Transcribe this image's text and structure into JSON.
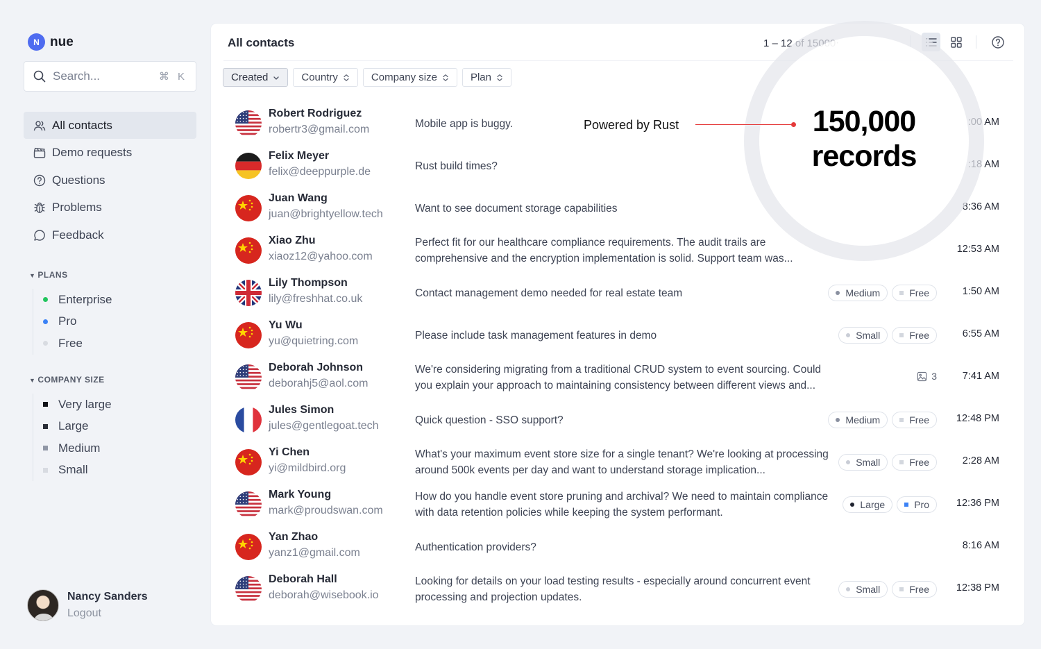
{
  "brand": {
    "logo_letter": "N",
    "name": "nue"
  },
  "search": {
    "placeholder": "Search...",
    "shortcut": "⌘ K"
  },
  "nav": [
    {
      "label": "All contacts",
      "icon": "users-icon",
      "active": true
    },
    {
      "label": "Demo requests",
      "icon": "clapperboard-icon",
      "active": false
    },
    {
      "label": "Questions",
      "icon": "question-circle-icon",
      "active": false
    },
    {
      "label": "Problems",
      "icon": "bug-icon",
      "active": false
    },
    {
      "label": "Feedback",
      "icon": "chat-bubble-icon",
      "active": false
    }
  ],
  "plans": {
    "heading": "PLANS",
    "items": [
      {
        "label": "Enterprise",
        "color": "#22c55e"
      },
      {
        "label": "Pro",
        "color": "#3b82f6"
      },
      {
        "label": "Free",
        "color": "#d8dbe1"
      }
    ]
  },
  "company_size": {
    "heading": "COMPANY SIZE",
    "items": [
      {
        "label": "Very large",
        "color": "#111318"
      },
      {
        "label": "Large",
        "color": "#2a2e38"
      },
      {
        "label": "Medium",
        "color": "#9097a6"
      },
      {
        "label": "Small",
        "color": "#d8dbe1"
      }
    ]
  },
  "user": {
    "name": "Nancy Sanders",
    "logout": "Logout"
  },
  "main": {
    "title": "All contacts",
    "pagination": "1 – 12 of 15000‧",
    "filters": [
      "Created",
      "Country",
      "Company size",
      "Plan"
    ]
  },
  "overlay": {
    "powered_by": "Powered by Rust",
    "big_line1": "150,000",
    "big_line2": "records"
  },
  "contacts": [
    {
      "name": "Robert Rodriguez",
      "email": "robertr3@gmail.com",
      "flag": "us",
      "message": "Mobile app is buggy.",
      "size": "",
      "plan": "",
      "attachments": "",
      "time": ":00 AM"
    },
    {
      "name": "Felix Meyer",
      "email": "felix@deeppurple.de",
      "flag": "de",
      "message": "Rust build times?",
      "size": "",
      "plan": "",
      "attachments": "",
      "time": ":18 AM"
    },
    {
      "name": "Juan Wang",
      "email": "juan@brightyellow.tech",
      "flag": "cn",
      "message": "Want to see document storage capabilities",
      "size": "",
      "plan": "",
      "attachments": "",
      "time": "8:36 AM"
    },
    {
      "name": "Xiao Zhu",
      "email": "xiaoz12@yahoo.com",
      "flag": "cn",
      "message": "Perfect fit for our healthcare compliance requirements. The audit trails are comprehensive and the encryption implementation is solid. Support team was...",
      "size": "",
      "plan": "",
      "attachments": "",
      "time": "12:53 AM"
    },
    {
      "name": "Lily Thompson",
      "email": "lily@freshhat.co.uk",
      "flag": "gb",
      "message": "Contact management demo needed for real estate team",
      "size": "Medium",
      "plan": "Free",
      "attachments": "",
      "time": "1:50 AM"
    },
    {
      "name": "Yu Wu",
      "email": "yu@quietring.com",
      "flag": "cn",
      "message": "Please include task management features in demo",
      "size": "Small",
      "plan": "Free",
      "attachments": "",
      "time": "6:55 AM"
    },
    {
      "name": "Deborah Johnson",
      "email": "deborahj5@aol.com",
      "flag": "us",
      "message": "We're considering migrating from a traditional CRUD system to event sourcing. Could you explain your approach to maintaining consistency between different views and...",
      "size": "",
      "plan": "",
      "attachments": "3",
      "time": "7:41 AM"
    },
    {
      "name": "Jules Simon",
      "email": "jules@gentlegoat.tech",
      "flag": "fr",
      "message": "Quick question - SSO support?",
      "size": "Medium",
      "plan": "Free",
      "attachments": "",
      "time": "12:48 PM"
    },
    {
      "name": "Yi Chen",
      "email": "yi@mildbird.org",
      "flag": "cn",
      "message": "What's your maximum event store size for a single tenant? We're looking at processing around 500k events per day and want to understand storage implication...",
      "size": "Small",
      "plan": "Free",
      "attachments": "",
      "time": "2:28 AM"
    },
    {
      "name": "Mark Young",
      "email": "mark@proudswan.com",
      "flag": "us",
      "message": "How do you handle event store pruning and archival? We need to maintain compliance with data retention policies while keeping the system performant.",
      "size": "Large",
      "plan": "Pro",
      "attachments": "",
      "time": "12:36 PM"
    },
    {
      "name": "Yan Zhao",
      "email": "yanz1@gmail.com",
      "flag": "cn",
      "message": "Authentication providers?",
      "size": "",
      "plan": "",
      "attachments": "",
      "time": "8:16 AM"
    },
    {
      "name": "Deborah Hall",
      "email": "deborah@wisebook.io",
      "flag": "us",
      "message": "Looking for details on your load testing results - especially around concurrent event processing and projection updates.",
      "size": "Small",
      "plan": "Free",
      "attachments": "",
      "time": "12:38 PM"
    }
  ],
  "tag_colors": {
    "Medium": "#8a90a0",
    "Small": "#c9cdd6",
    "Large": "#1f2330",
    "Free": "#d3d7de",
    "Pro": "#3b82f6"
  }
}
